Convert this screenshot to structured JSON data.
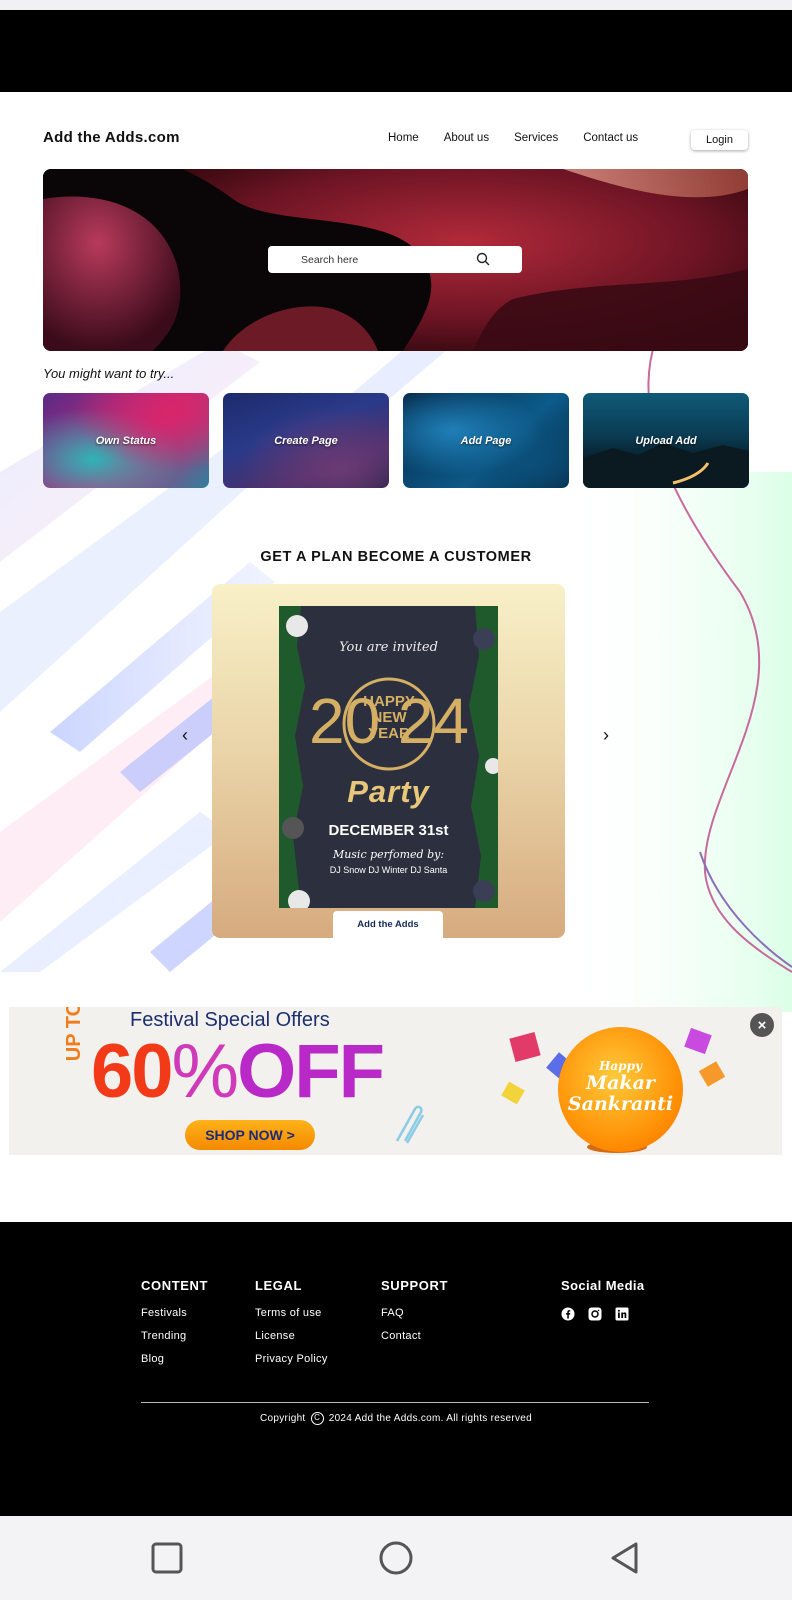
{
  "header": {
    "brand": "Add the Adds.com",
    "nav": [
      "Home",
      "About us",
      "Services",
      "Contact us"
    ],
    "login_label": "Login"
  },
  "hero": {
    "search_placeholder": "Search here"
  },
  "try_section": {
    "label": "You might want to try...",
    "tiles": [
      "Own Status",
      "Create Page",
      "Add Page",
      "Upload Add"
    ]
  },
  "plans": {
    "title": "GET A PLAN BECOME A CUSTOMER",
    "flyer": {
      "invite": "You are invited",
      "year_top": "20",
      "year_bottom": "24",
      "happy": "HAPPY",
      "new": "NEW",
      "year_word": "YEAR",
      "party": "Party",
      "date": "DECEMBER 31st",
      "music": "Music perfomed by:",
      "djs": "DJ Snow   DJ Winter   DJ Santa"
    },
    "button_label": "Add the Adds"
  },
  "ad": {
    "heading": "Festival Special Offers",
    "upto": "UP TO",
    "discount_number": "60",
    "discount_percent": "%",
    "discount_off": "OFF",
    "shop_label": "SHOP NOW >",
    "festival_happy": "Happy",
    "festival_name_1": "Makar",
    "festival_name_2": "Sankranti",
    "close_label": "×"
  },
  "footer": {
    "columns": [
      {
        "heading": "CONTENT",
        "links": [
          "Festivals",
          "Trending",
          "Blog"
        ]
      },
      {
        "heading": "LEGAL",
        "links": [
          "Terms of use",
          "License",
          "Privacy Policy"
        ]
      },
      {
        "heading": "SUPPORT",
        "links": [
          "FAQ",
          "Contact"
        ]
      }
    ],
    "social_heading": "Social Media",
    "social_icons": [
      "facebook-icon",
      "instagram-icon",
      "linkedin-icon"
    ],
    "copyright_prefix": "Copyright",
    "copyright_text": "2024 Add the Adds.com. All rights reserved"
  },
  "colors": {
    "accent_navy": "#1d2f6d",
    "offer_red": "#f33a18",
    "offer_purple": "#b829c8",
    "shop_orange": "#f58a00"
  }
}
